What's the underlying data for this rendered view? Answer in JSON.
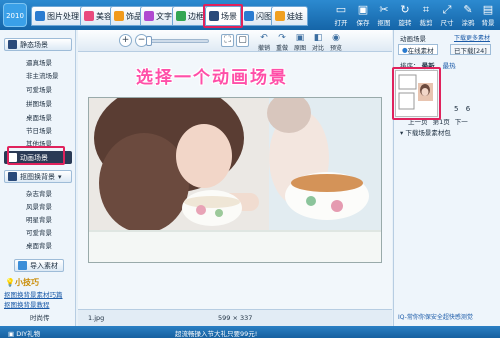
{
  "app": {
    "logo_text": "2010"
  },
  "tabs": [
    {
      "label": "图片处理",
      "color": "#2a7bd0"
    },
    {
      "label": "美容",
      "color": "#e94a7d"
    },
    {
      "label": "饰品",
      "color": "#f19a1c"
    },
    {
      "label": "文字",
      "color": "#b04ad0"
    },
    {
      "label": "边框",
      "color": "#33a652"
    },
    {
      "label": "场景",
      "color": "#2a4a7a"
    },
    {
      "label": "闪图",
      "color": "#2a7bd0"
    },
    {
      "label": "娃娃",
      "color": "#f0a020"
    }
  ],
  "toolbar": [
    {
      "label": "打开",
      "icon": "folder-icon"
    },
    {
      "label": "保存",
      "icon": "save-icon"
    },
    {
      "label": "抠图",
      "icon": "cutout-icon"
    },
    {
      "label": "旋转",
      "icon": "rotate-icon"
    },
    {
      "label": "裁剪",
      "icon": "crop-icon"
    },
    {
      "label": "尺寸",
      "icon": "resize-icon"
    },
    {
      "label": "涂鸦",
      "icon": "brush-icon"
    },
    {
      "label": "背景",
      "icon": "background-icon"
    }
  ],
  "sidebar": {
    "static_section": "静态场景",
    "static_items": [
      "逼真场景",
      "非主流场景",
      "可爱场景",
      "拼图场景",
      "桌面场景",
      "节日场景",
      "其他场景"
    ],
    "animated_section": "动画场景",
    "cutout_section": "抠图换背景",
    "cutout_items": [
      "杂志背景",
      "风景背景",
      "明星背景",
      "可爱背景",
      "桌面背景"
    ],
    "import_button": "导入素材",
    "tips_title": "小技巧",
    "tips_links": [
      "抠图换背景素材巧篇",
      "抠图换背景教程"
    ],
    "tips_bottom": "时尚传"
  },
  "canvas_toolbar": {
    "zoom_in": "+",
    "zoom_out": "−",
    "actions": [
      "撤销",
      "重做",
      "原图",
      "对比",
      "预览"
    ]
  },
  "overlay_text": "选择一个动画场景",
  "status": {
    "filename": "1.jpg",
    "dimensions": "599 × 337"
  },
  "right_panel": {
    "header": "动画场景",
    "more_link": "下载更多素材",
    "tab_online": "在线素材",
    "tab_downloaded": "已下载[24]",
    "sort_label": "排序：",
    "sort_latest": "最新",
    "sort_hot": "最热",
    "pages": [
      "5",
      "6"
    ],
    "prev_page": "上一页",
    "page_no": "第1页",
    "next_page": "下一",
    "download_pack": "下载场景素材包",
    "bottom_note": "IQ-常你你保安全超快感测觉"
  },
  "footer": {
    "left": "DIY礼物",
    "center": "超流畅操入节大礼只要99元!"
  }
}
